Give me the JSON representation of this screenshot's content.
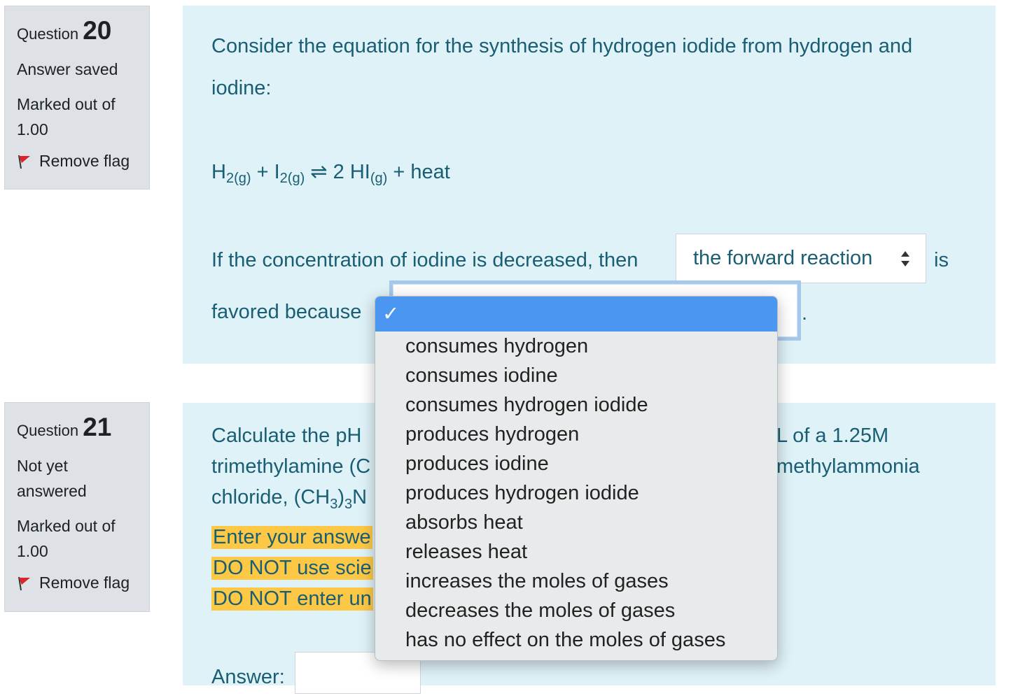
{
  "q20": {
    "label": "Question",
    "number": "20",
    "state": "Answer saved",
    "grade_line1": "Marked out of",
    "grade_line2": "1.00",
    "flag": "Remove flag",
    "intro_line1": "Consider the equation for the synthesis of hydrogen iodide from hydrogen and",
    "intro_line2": "iodine:",
    "eq": {
      "h": "H",
      "h_sub": "2(g)",
      "plus1": " + ",
      "i": "I",
      "i_sub": "2(g)",
      "arrow": " ⇌ ",
      "product": "2 HI",
      "product_sub": "(g)",
      "tail": " + heat"
    },
    "sentence_start": "If the concentration of iodine is decreased, then",
    "select1_value": "the forward reaction",
    "sentence_is": "is",
    "favored": "favored because",
    "period": "."
  },
  "q21": {
    "label": "Question",
    "number": "21",
    "state_line1": "Not yet",
    "state_line2": "answered",
    "grade_line1": "Marked out of",
    "grade_line2": "1.00",
    "flag": "Remove flag",
    "l1_left": "Calculate the pH",
    "l1_right": "L of a 1.25M",
    "l2_left": "trimethylamine (C",
    "l2_right": "methylammonia",
    "l3_left": "chloride, (CH",
    "l3_sub1": "3",
    "l3_mid": ")",
    "l3_sub2": "3",
    "l3_end": "N",
    "hl1": "Enter your answe",
    "hl2": "DO NOT use scie",
    "hl3": "DO NOT enter un",
    "answer_label": "Answer:"
  },
  "dropdown": {
    "selected_mark": "✓",
    "options": [
      "consumes hydrogen",
      "consumes iodine",
      "consumes hydrogen iodide",
      "produces hydrogen",
      "produces iodine",
      "produces hydrogen iodide",
      "absorbs heat",
      "releases heat",
      "increases the moles of gases",
      "decreases the moles of gases",
      "has no effect on the moles of gases"
    ]
  },
  "colors": {
    "flag": "#d9252b",
    "select_highlight": "#4a96f0",
    "content_bg": "#def2f8"
  }
}
